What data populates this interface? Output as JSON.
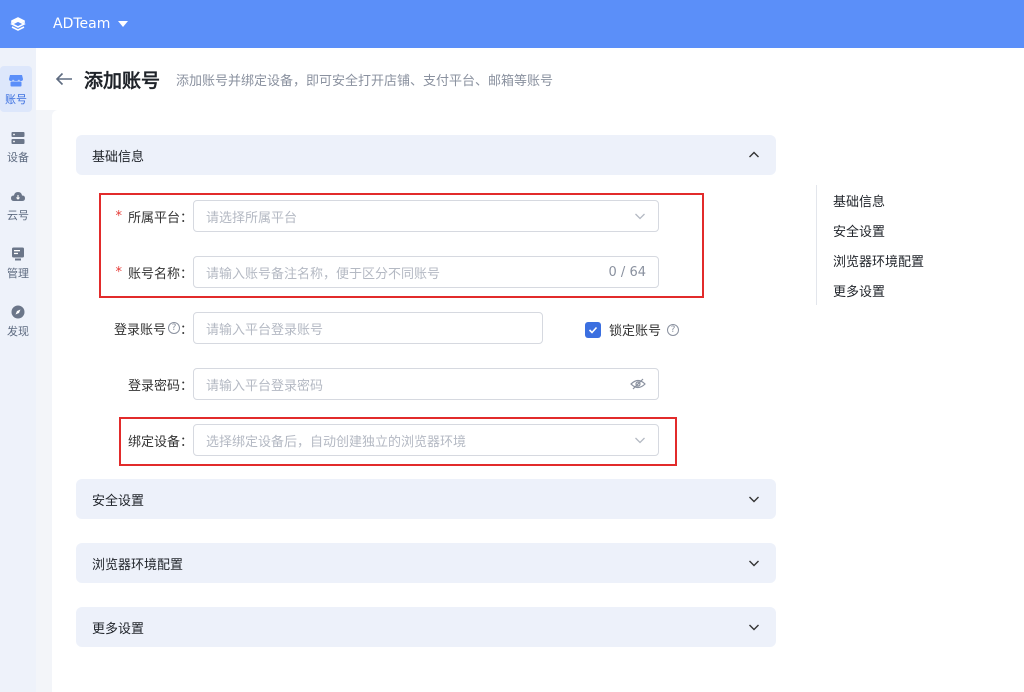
{
  "topbar": {
    "team_name": "ADTeam",
    "accent": "#5b8ff9"
  },
  "sidebar": {
    "items": [
      {
        "label": "账号",
        "icon": "shop-icon",
        "active": true
      },
      {
        "label": "设备",
        "icon": "server-icon",
        "active": false
      },
      {
        "label": "云号",
        "icon": "cloud-icon",
        "active": false
      },
      {
        "label": "管理",
        "icon": "manage-icon",
        "active": false
      },
      {
        "label": "发现",
        "icon": "compass-icon",
        "active": false
      }
    ]
  },
  "header": {
    "title": "添加账号",
    "subtitle": "添加账号并绑定设备，即可安全打开店铺、支付平台、邮箱等账号"
  },
  "sections": {
    "basic": "基础信息",
    "security": "安全设置",
    "browser": "浏览器环境配置",
    "more": "更多设置"
  },
  "form": {
    "platform": {
      "label": "所属平台：",
      "placeholder": "请选择所属平台",
      "required": true
    },
    "account_name": {
      "label": "账号名称：",
      "placeholder": "请输入账号备注名称，便于区分不同账号",
      "counter": "0 / 64",
      "required": true
    },
    "login_account": {
      "label": "登录账号",
      "suffix": "：",
      "placeholder": "请输入平台登录账号"
    },
    "lock_account": {
      "label": "锁定账号",
      "checked": true
    },
    "login_password": {
      "label": "登录密码：",
      "placeholder": "请输入平台登录密码"
    },
    "bind_device": {
      "label": "绑定设备：",
      "placeholder": "选择绑定设备后，自动创建独立的浏览器环境"
    }
  },
  "anchor_nav": [
    "基础信息",
    "安全设置",
    "浏览器环境配置",
    "更多设置"
  ],
  "colors": {
    "required": "#e53935",
    "highlight_box": "#e22b2b",
    "checkbox": "#3b6fe0"
  }
}
